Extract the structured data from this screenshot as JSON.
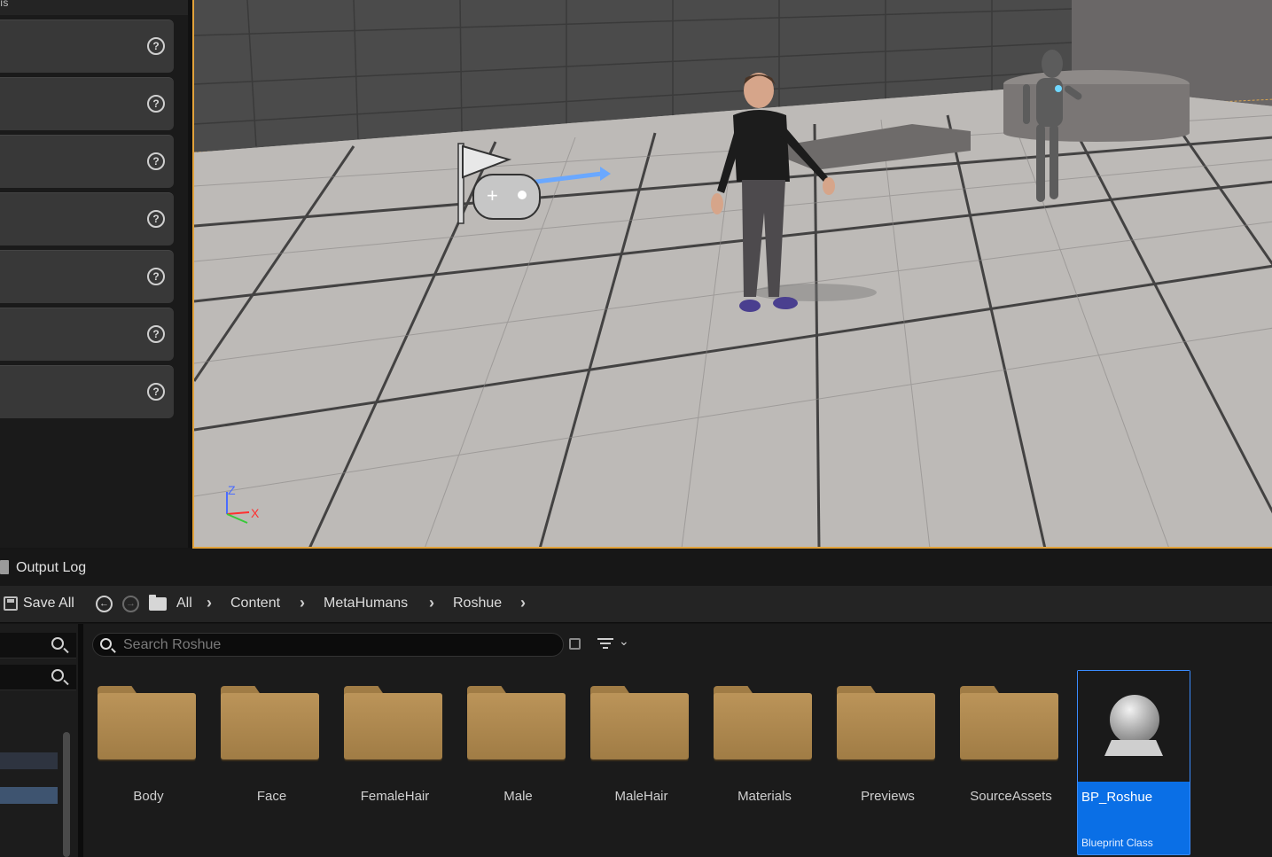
{
  "left_panel": {
    "header_fragment": "ıs",
    "rows": [
      {
        "help_icon": "question-circle-icon"
      },
      {
        "help_icon": "question-circle-icon"
      },
      {
        "help_icon": "question-circle-icon"
      },
      {
        "help_icon": "question-circle-icon"
      },
      {
        "help_icon": "question-circle-icon"
      },
      {
        "help_icon": "question-circle-icon"
      },
      {
        "help_icon": "question-circle-icon"
      }
    ]
  },
  "viewport": {
    "axis_labels": {
      "z": "Z",
      "x": "X"
    },
    "colors": {
      "selection_border": "#e2a23a",
      "floor": "#bdbab7",
      "wall": "#4a4a4a"
    }
  },
  "output_log": {
    "label": "Output Log"
  },
  "toolbar": {
    "save_all_label": "Save All",
    "breadcrumbs": [
      "All",
      "Content",
      "MetaHumans",
      "Roshue"
    ]
  },
  "content_browser": {
    "search_placeholder": "Search Roshue",
    "folders": [
      "Body",
      "Face",
      "FemaleHair",
      "Male",
      "MaleHair",
      "Materials",
      "Previews",
      "SourceAssets"
    ],
    "selected_asset": {
      "name": "BP_Roshue",
      "type": "Blueprint Class"
    },
    "colors": {
      "folder": "#bb9459",
      "selection": "#0a6fe6"
    }
  }
}
